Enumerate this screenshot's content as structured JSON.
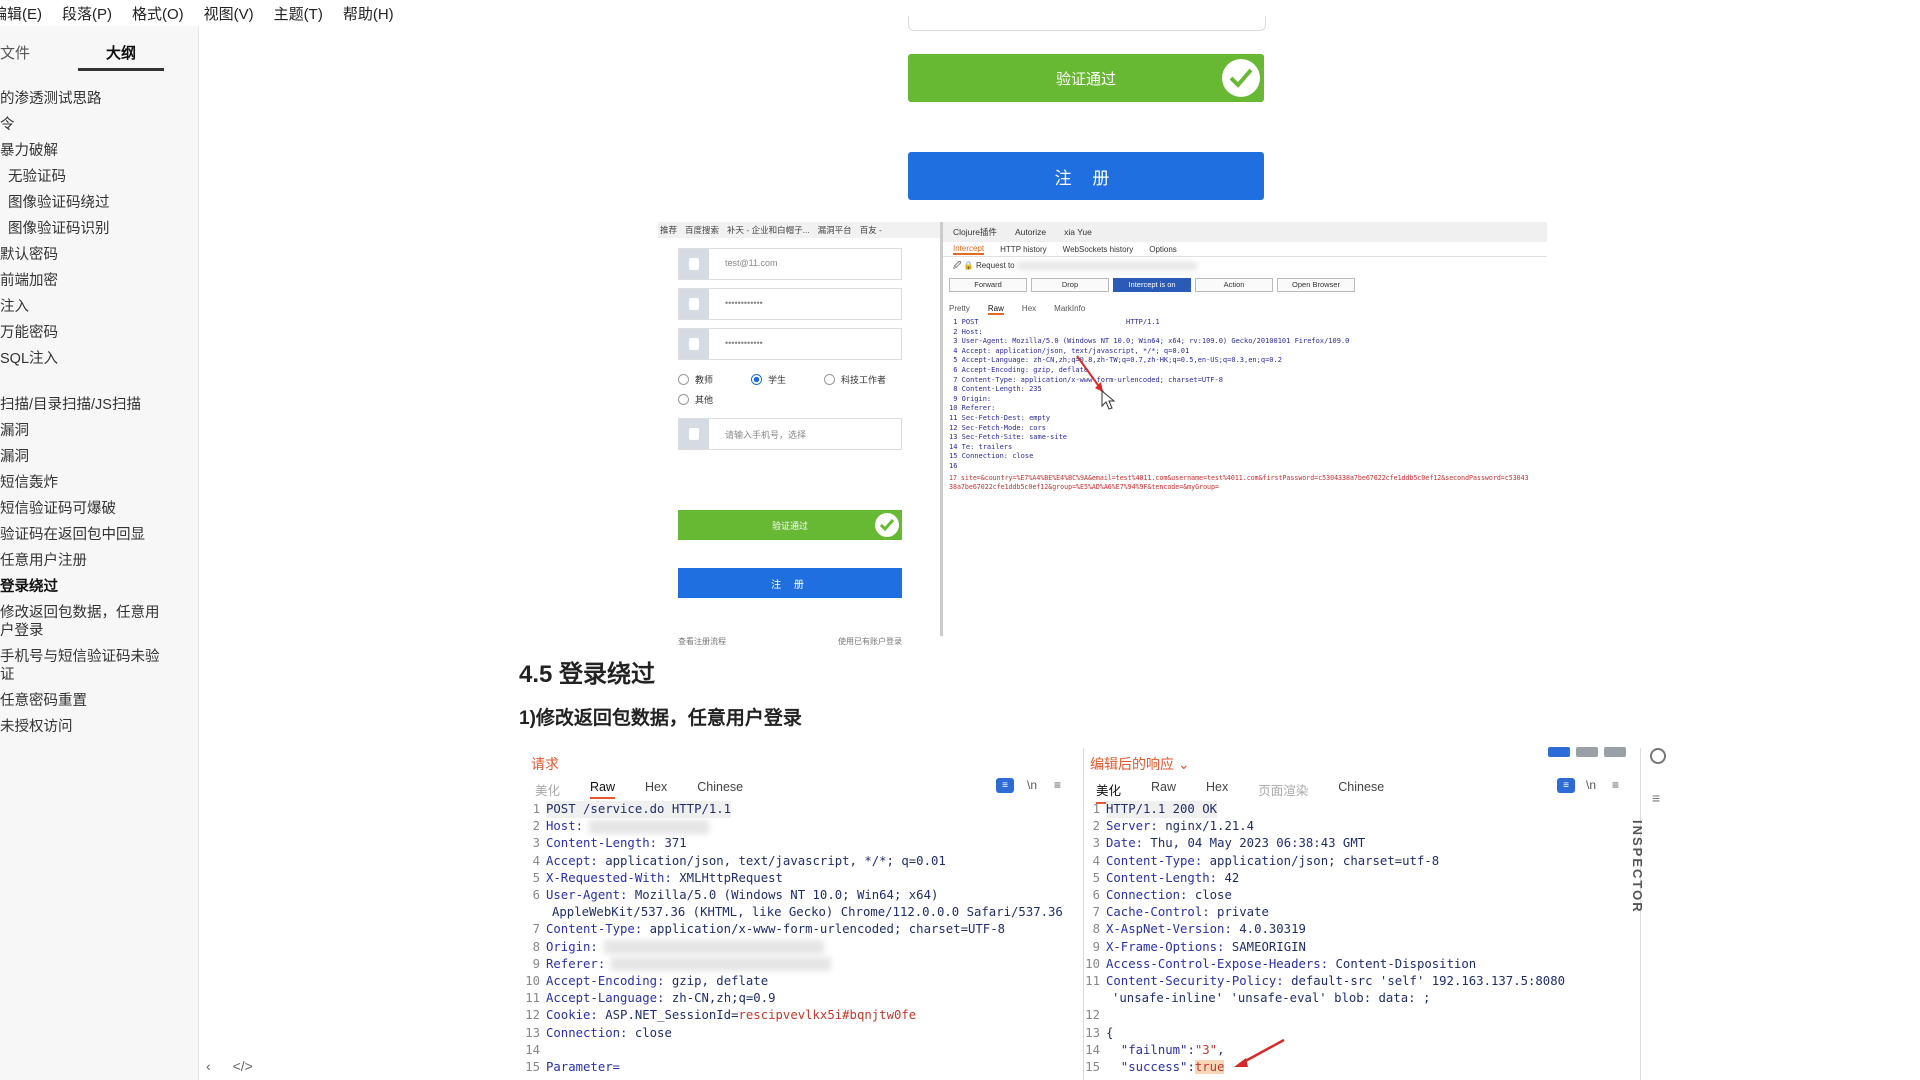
{
  "menubar": [
    "编辑(E)",
    "段落(P)",
    "格式(O)",
    "视图(V)",
    "主题(T)",
    "帮助(H)"
  ],
  "sidebar": {
    "tab_files": "文件",
    "tab_outline": "大纲",
    "items": [
      {
        "label": "的渗透测试思路"
      },
      {
        "label": "令"
      },
      {
        "label": "暴力破解"
      },
      {
        "label": "无验证码",
        "indent": true
      },
      {
        "label": "图像验证码绕过",
        "indent": true
      },
      {
        "label": "图像验证码识别",
        "indent": true
      },
      {
        "label": "默认密码"
      },
      {
        "label": "前端加密"
      },
      {
        "label": "注入"
      },
      {
        "label": "万能密码"
      },
      {
        "label": "SQL注入"
      },
      {
        "label": "扫描/目录扫描/JS扫描",
        "gap": true
      },
      {
        "label": "漏洞"
      },
      {
        "label": "漏洞"
      },
      {
        "label": "短信轰炸"
      },
      {
        "label": "短信验证码可爆破"
      },
      {
        "label": "验证码在返回包中回显"
      },
      {
        "label": "任意用户注册"
      },
      {
        "label": "登录绕过",
        "active": true
      },
      {
        "label": "修改返回包数据，任意用户登录",
        "wrap": true
      },
      {
        "label": "手机号与短信验证码未验证",
        "wrap": true
      },
      {
        "label": "任意密码重置"
      },
      {
        "label": "未授权访问"
      }
    ],
    "foot_back": "‹",
    "foot_code": "</>"
  },
  "upper": {
    "verify_label": "验证通过",
    "register_label": "注 册"
  },
  "screenshot": {
    "bookmarks": [
      "推荐",
      "百度搜索",
      "补天 - 企业和白帽子...",
      "漏洞平台",
      "百友 -"
    ],
    "email_placeholder": "test@11.com",
    "pwd1": "••••••••••••",
    "pwd2": "••••••••••••",
    "radio_teacher": "教师",
    "radio_student": "学生",
    "radio_research": "科技工作者",
    "radio_other": "其他",
    "captcha_placeholder": "请输入手机号，选择",
    "verify_label": "验证通过",
    "register_label": "注 册",
    "foot_left": "查看注册流程",
    "foot_right": "使用已有账户登录",
    "burp_tabs": [
      "Clojure插件",
      "Autorize",
      "xia Yue"
    ],
    "burp_subtabs": [
      "Intercept",
      "HTTP history",
      "WebSockets history",
      "Options"
    ],
    "burp_request_label": "Request to",
    "burp_buttons": [
      "Forward",
      "Drop",
      "Intercept is on",
      "Action",
      "Open Browser"
    ],
    "burp_viewtabs": [
      "Pretty",
      "Raw",
      "Hex",
      "MarkInfo"
    ],
    "burp_code": " 1 POST                                   HTTP/1.1\n 2 Host:\n 3 User-Agent: Mozilla/5.0 (Windows NT 10.0; Win64; x64; rv:109.0) Gecko/20100101 Firefox/109.0\n 4 Accept: application/json, text/javascript, */*; q=0.01\n 5 Accept-Language: zh-CN,zh;q=0.8,zh-TW;q=0.7,zh-HK;q=0.5,en-US;q=0.3,en;q=0.2\n 6 Accept-Encoding: gzip, deflate\n 7 Content-Type: application/x-www-form-urlencoded; charset=UTF-8\n 8 Content-Length: 235\n 9 Origin:\n10 Referer:\n11 Sec-Fetch-Dest: empty\n12 Sec-Fetch-Mode: cors\n13 Sec-Fetch-Site: same-site\n14 Te: trailers\n15 Connection: close\n16",
    "burp_param": "17 site=&country=%E7%A4%BE%E4%BC%9A&email=test%4011.com&username=test%4011.com&firstPassword=c5304338a7be67022cfe1ddb5c0ef12&secondPassword=c5304338a7be67022cfe1ddb5c0ef12&group=%E5%AD%A6%E7%94%9F&tencode=&myGroup="
  },
  "heading_45": "4.5 登录绕过",
  "heading_1": "1)修改返回包数据，任意用户登录",
  "request": {
    "title": "请求",
    "tabs": [
      "美化",
      "Raw",
      "Hex",
      "Chinese"
    ],
    "lines": [
      {
        "n": "1",
        "t": "POST /service.do HTTP/1.1"
      },
      {
        "n": "2",
        "k": "Host:",
        "v": ""
      },
      {
        "n": "3",
        "k": "Content-Length:",
        "v": " 371"
      },
      {
        "n": "4",
        "k": "Accept:",
        "v": " application/json, text/javascript, */*; q=0.01"
      },
      {
        "n": "5",
        "k": "X-Requested-With:",
        "v": " XMLHttpRequest"
      },
      {
        "n": "6",
        "k": "User-Agent:",
        "v": " Mozilla/5.0 (Windows NT 10.0; Win64; x64)"
      },
      {
        "n": "",
        "k": "",
        "v": "AppleWebKit/537.36 (KHTML, like Gecko) Chrome/112.0.0.0 Safari/537.36"
      },
      {
        "n": "7",
        "k": "Content-Type:",
        "v": " application/x-www-form-urlencoded; charset=UTF-8"
      },
      {
        "n": "8",
        "k": "Origin:",
        "v": ""
      },
      {
        "n": "9",
        "k": "Referer:",
        "v": ""
      },
      {
        "n": "10",
        "k": "Accept-Encoding:",
        "v": " gzip, deflate"
      },
      {
        "n": "11",
        "k": "Accept-Language:",
        "v": " zh-CN,zh;q=0.9"
      },
      {
        "n": "12",
        "k": "Cookie:",
        "v": " ASP.NET_SessionId=",
        "r": "rescipvevlkx5i#bqnjtw0fe"
      },
      {
        "n": "13",
        "k": "Connection:",
        "v": " close"
      },
      {
        "n": "14",
        "k": "",
        "v": ""
      },
      {
        "n": "15",
        "k": "Parameter=",
        "v": ""
      }
    ]
  },
  "response": {
    "title": "编辑后的响应",
    "tabs": [
      "美化",
      "Raw",
      "Hex",
      "页面渲染",
      "Chinese"
    ],
    "lines": [
      {
        "n": "1",
        "t": "HTTP/1.1 200 OK"
      },
      {
        "n": "2",
        "k": "Server:",
        "v": " nginx/1.21.4"
      },
      {
        "n": "3",
        "k": "Date:",
        "v": " Thu, 04 May 2023 06:38:43 GMT"
      },
      {
        "n": "4",
        "k": "Content-Type:",
        "v": " application/json; charset=utf-8"
      },
      {
        "n": "5",
        "k": "Content-Length:",
        "v": " 42"
      },
      {
        "n": "6",
        "k": "Connection:",
        "v": " close"
      },
      {
        "n": "7",
        "k": "Cache-Control:",
        "v": " private"
      },
      {
        "n": "8",
        "k": "X-AspNet-Version:",
        "v": " 4.0.30319"
      },
      {
        "n": "9",
        "k": "X-Frame-Options:",
        "v": " SAMEORIGIN"
      },
      {
        "n": "10",
        "k": "Access-Control-Expose-Headers:",
        "v": " Content-Disposition"
      },
      {
        "n": "11",
        "k": "Content-Security-Policy:",
        "v": " default-src 'self' 192.163.137.5:8080"
      },
      {
        "n": "",
        "k": "",
        "v": "'unsafe-inline' 'unsafe-eval' blob: data: ;"
      },
      {
        "n": "12",
        "k": "",
        "v": ""
      },
      {
        "n": "13",
        "k": "",
        "v": "{"
      },
      {
        "n": "14",
        "k": "  \"failnum\"",
        "v": ":",
        "r": "\"3\"",
        "after": ","
      },
      {
        "n": "15",
        "k": "  \"success\"",
        "v": ":",
        "h": "true"
      }
    ],
    "inspector": "INSPECTOR"
  }
}
